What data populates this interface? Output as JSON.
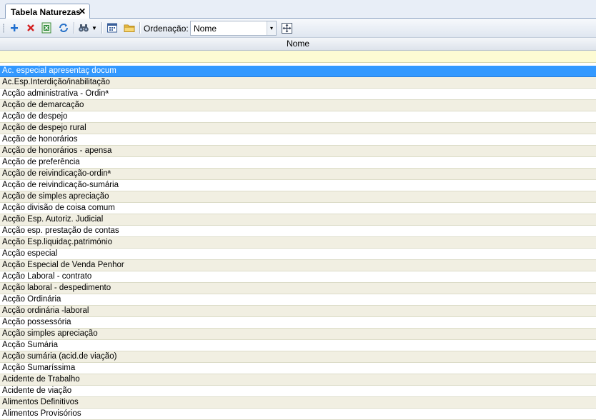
{
  "tab": {
    "title": "Tabela Naturezas",
    "close": "✕"
  },
  "toolbar": {
    "ordering_label": "Ordenação:",
    "ordering_value": "Nome",
    "arrow": "▼",
    "dropdown_arrow": "▾"
  },
  "grid": {
    "column_header": "Nome",
    "rows": [
      "Ac. especial apresentaç docum",
      "Ac.Esp.Interdição/inabilitação",
      "Acção administrativa - Ordinª",
      "Acção de demarcação",
      "Acção de despejo",
      "Acção de despejo rural",
      "Acção de honorários",
      "Acção de honorários - apensa",
      "Acção de preferência",
      "Acção de reivindicação-ordinª",
      "Acção de reivindicação-sumária",
      "Acção de simples apreciação",
      "Acção divisão de coisa comum",
      "Acção Esp. Autoriz. Judicial",
      "Acção esp. prestação de contas",
      "Acção Esp.liquidaç.património",
      "Acção especial",
      "Acção Especial de Venda Penhor",
      "Acção Laboral - contrato",
      "Acção laboral - despedimento",
      "Acção Ordinária",
      "Acção ordinária -laboral",
      "Acção possessória",
      "Acção simples apreciação",
      "Acção Sumária",
      "Acção sumária (acid.de viação)",
      "Acção Sumaríssima",
      "Acidente de Trabalho",
      "Acidente de viação",
      "Alimentos Definitivos",
      "Alimentos Provisórios"
    ],
    "selected_index": 0
  },
  "colors": {
    "selection": "#3399ff",
    "row_alt": "#f1efe2",
    "filter_row": "#fdfbd3"
  }
}
